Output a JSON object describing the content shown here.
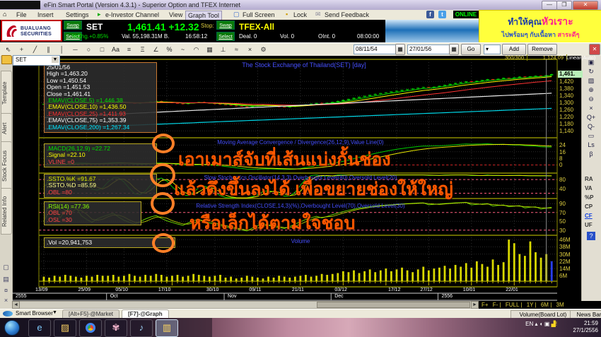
{
  "window": {
    "title": "eFin Smart Portal (Version 4.3.1) - Superior Option and TFEX Internet"
  },
  "menu": {
    "items": [
      "File",
      "Insert",
      "Settings",
      "e-Investor Channel",
      "View",
      "Graph Tool",
      "Full Screen",
      "Lock",
      "Send Feedback"
    ],
    "online": "ONLINE"
  },
  "banner": {
    "l1a": "ทำให้คุณ",
    "l1b": "หัวเราะ",
    "l2a": "ไปพร้อมๆ กับเนื้อหา",
    "l2b": "สาระดีๆ"
  },
  "quote": {
    "swap": "Swap",
    "select": "Select",
    "broker": {
      "line1": "BUALUANG",
      "line2": "SECURITIES"
    },
    "set": {
      "symbol": "SET",
      "last": "1,461.41 +12.32",
      "pct": "%Chg.+0.85%",
      "val": "Val. 55,198.31M B.",
      "time": "16:58:12",
      "stop": "Stop:"
    },
    "tfex": {
      "symbol": "TFEX-All",
      "deal": "Deal. 0",
      "vol": "Vol. 0",
      "oint": "OInt. 0",
      "time": "08:00:00"
    }
  },
  "toolbar": {
    "tools": [
      "pointer",
      "crosshair",
      "trend-line",
      "parallel-lines",
      "vertical-line",
      "horizontal-line",
      "ellipse",
      "rectangle",
      "text",
      "fibonacci",
      "extension",
      "angle",
      "percent",
      "wave",
      "arc",
      "grid",
      "ruler",
      "pattern",
      "delete",
      "settings"
    ],
    "date_from": "08/11/54",
    "date_to": "27/01/56",
    "go": "Go",
    "add": "Add",
    "remove": "Remove"
  },
  "chart_header": {
    "bars": "300/300",
    "value": "1,124.09",
    "scale": "Linear(Auto)"
  },
  "symbol_combo": {
    "value": "SET"
  },
  "sidebar": {
    "tabs": [
      "Template",
      "Alert",
      "Stock Focus",
      "Related Info"
    ]
  },
  "panes": {
    "price_title": "The Stock Exchange of Thailand(SET) [day]",
    "macd_title": "Moving Average Convergence / Divergence(26,12,9),Value Line(0)",
    "stoch_title": "Slow Stochastics Oscillator(14,3,3),Overbought Level(80),Oversold Level(20)",
    "rsi_title": "Relative Strength Index(CLOSE,14,3)(%),Overbought Level(70),Oversold Level(30)",
    "vol_title": "Volume"
  },
  "info_boxes": {
    "price": {
      "rows": [
        {
          "l": "25/01/56",
          "v": "",
          "c": "#ffffff"
        },
        {
          "l": "High",
          "v": "=1,463.20",
          "c": "#ffffff"
        },
        {
          "l": "Low",
          "v": "=1,450.54",
          "c": "#ffffff"
        },
        {
          "l": "Open",
          "v": "=1,451.53",
          "c": "#ffffff"
        },
        {
          "l": "Close",
          "v": "=1,461.41",
          "c": "#ffffff"
        },
        {
          "l": ".EMAV(CLOSE,5)",
          "v": "=1,446.38",
          "c": "#00dd00"
        },
        {
          "l": ".EMAV(CLOSE,10)",
          "v": "=1,436.50",
          "c": "#ffff00"
        },
        {
          "l": ".EMAV(CLOSE,25)",
          "v": "=1,411.93",
          "c": "#ff3333"
        },
        {
          "l": ".EMAV(CLOSE,75)",
          "v": "=1,353.39",
          "c": "#ffffff"
        },
        {
          "l": ".EMAV(CLOSE,200)",
          "v": "=1,267.34",
          "c": "#00e5ff"
        }
      ]
    },
    "macd": {
      "rows": [
        {
          "l": ".MACD(26,12,9)",
          "v": "=22.72",
          "c": "#00dd00"
        },
        {
          "l": ".Signal",
          "v": "=22.10",
          "c": "#ffff00"
        },
        {
          "l": ".VLINE",
          "v": "=0",
          "c": "#ff4444"
        }
      ]
    },
    "ssto": {
      "rows": [
        {
          "l": ".SSTO.%K",
          "v": "=91.67",
          "c": "#d8e600"
        },
        {
          "l": ".SSTO.%D",
          "v": "=85.59",
          "c": "#ffff88"
        },
        {
          "l": ".OBL",
          "v": "=80",
          "c": "#ff4444"
        }
      ]
    },
    "rsi": {
      "rows": [
        {
          "l": ".RSI(14)",
          "v": "=77.36",
          "c": "#88ff00"
        },
        {
          "l": ".OBL",
          "v": "=70",
          "c": "#ff4444"
        },
        {
          "l": ".OSL",
          "v": "=30",
          "c": "#ff4444"
        }
      ]
    },
    "vol": {
      "rows": [
        {
          "l": ".Vol",
          "v": "=20,941,753",
          "c": "#ffffff"
        }
      ]
    }
  },
  "annotations": {
    "t1": "เอาเมาส์จับที่เส้นแบ่งกั้นช่อง",
    "t2": "แล้วดึงขึ้นลงได้ เพื่อขยายช่องให้ใหญ่",
    "t3": "หรือเล็กได้ตามใจชอบ"
  },
  "scrollbar": {
    "buttons": [
      "F+",
      "F-",
      "FULL",
      "1Y",
      "6M",
      "3M"
    ]
  },
  "statusbar": {
    "browser": "Smart Browser",
    "tab_market": "[Alt+F5]-@Market",
    "tab_graph": "[F7]-@Graph",
    "volume_btn": "Volume(Board Lot)",
    "news_btn": "News Bar"
  },
  "taskbar": {
    "lang": "EN",
    "time": "21:59",
    "date": "27/1/2556"
  },
  "right_tools": [
    "chart-window",
    "refresh",
    "image",
    "zoom-in",
    "zoom-out",
    "clear",
    "magnify-plus",
    "magnify-minus",
    "monitor",
    "last-sale",
    "beta"
  ],
  "right_labels": [
    "RA",
    "VA",
    "%P",
    "CP",
    "CF",
    "UF"
  ],
  "chart_data": {
    "type": "candlestick",
    "title": "The Stock Exchange of Thailand(SET) [day]",
    "symbol": "SET",
    "interval": "day",
    "closes": [
      1293,
      1296,
      1299,
      1295,
      1300,
      1303,
      1306,
      1301,
      1298,
      1295,
      1299,
      1302,
      1305,
      1308,
      1304,
      1300,
      1297,
      1294,
      1298,
      1302,
      1306,
      1309,
      1305,
      1301,
      1298,
      1295,
      1292,
      1296,
      1300,
      1303,
      1299,
      1296,
      1293,
      1290,
      1287,
      1284,
      1281,
      1278,
      1275,
      1279,
      1283,
      1286,
      1282,
      1279,
      1276,
      1274,
      1277,
      1281,
      1285,
      1290,
      1294,
      1298,
      1295,
      1299,
      1304,
      1309,
      1315,
      1321,
      1327,
      1333,
      1338,
      1344,
      1349,
      1354,
      1358,
      1363,
      1367,
      1372,
      1376,
      1380,
      1384,
      1388,
      1385,
      1390,
      1395,
      1400,
      1406,
      1411,
      1416,
      1421,
      1417,
      1423,
      1428,
      1433,
      1429,
      1435,
      1440,
      1437,
      1442,
      1447,
      1443,
      1449,
      1452,
      1448,
      1455,
      1461
    ],
    "volumes_m": [
      5,
      4,
      6,
      5,
      7,
      6,
      5,
      4,
      6,
      5,
      7,
      6,
      6,
      7,
      5,
      6,
      8,
      6,
      5,
      7,
      6,
      8,
      7,
      5,
      6,
      7,
      5,
      6,
      8,
      7,
      6,
      5,
      6,
      7,
      4,
      5,
      3,
      4,
      6,
      5,
      4,
      3,
      5,
      4,
      6,
      5,
      4,
      5,
      6,
      7,
      5,
      6,
      8,
      7,
      8,
      9,
      11,
      10,
      12,
      9,
      11,
      13,
      10,
      12,
      14,
      11,
      13,
      15,
      12,
      10,
      13,
      16,
      12,
      14,
      15,
      17,
      14,
      18,
      16,
      20,
      15,
      22,
      19,
      16,
      24,
      18,
      21,
      46,
      42,
      30,
      28,
      44,
      32,
      26,
      30,
      22
    ],
    "overlays": {
      "ema5_last": 1446.38,
      "ema10_last": 1436.5,
      "ema25_last": 1411.93,
      "ema75_from": 1215,
      "ema75_to": 1353.39,
      "ema200_from": 1152,
      "ema200_to": 1267.34
    },
    "indicators": {
      "macd_last": 22.72,
      "signal_last": 22.1,
      "ssto_k_last": 91.67,
      "ssto_d_last": 85.59,
      "rsi_last": 77.36,
      "vol_last": "20,941,753"
    },
    "ranges": {
      "price": [
        1105,
        1545
      ],
      "macd": [
        -9,
        32
      ],
      "stoch": [
        0,
        105
      ],
      "rsi": [
        20,
        100
      ],
      "vol_m": [
        0,
        50
      ]
    },
    "levels": {
      "stoch_ob": 80,
      "stoch_os": 20,
      "rsi_ob": 70,
      "rsi_os": 30,
      "macd_zero": 0
    },
    "axis": {
      "price_ticks": [
        {
          "label": "1,420",
          "v": 1420
        },
        {
          "label": "1,380",
          "v": 1380
        },
        {
          "label": "1,340",
          "v": 1340
        },
        {
          "label": "1,300",
          "v": 1300
        },
        {
          "label": "1,260",
          "v": 1260
        },
        {
          "label": "1,220",
          "v": 1220
        },
        {
          "label": "1,180",
          "v": 1180
        },
        {
          "label": "1,140",
          "v": 1140
        }
      ],
      "price_current": {
        "label": "1,461.",
        "v": 1461
      },
      "macd_ticks": [
        24,
        16,
        8,
        0
      ],
      "stoch_ticks": [
        80,
        40
      ],
      "rsi_ticks": [
        90,
        70,
        50,
        30
      ],
      "vol_ticks": [
        {
          "label": "46M",
          "v": 46
        },
        {
          "label": "38M",
          "v": 38
        },
        {
          "label": "30M",
          "v": 30
        },
        {
          "label": "22M",
          "v": 22
        },
        {
          "label": "14M",
          "v": 14
        },
        {
          "label": "6M",
          "v": 6
        }
      ],
      "dates": [
        {
          "label": "13/09",
          "i": 0
        },
        {
          "label": "25/09",
          "i": 8
        },
        {
          "label": "05/10",
          "i": 15
        },
        {
          "label": "17/10",
          "i": 23
        },
        {
          "label": "30/10",
          "i": 32
        },
        {
          "label": "09/11",
          "i": 40
        },
        {
          "label": "21/11",
          "i": 48
        },
        {
          "label": "03/12",
          "i": 56
        },
        {
          "label": "17/12",
          "i": 66
        },
        {
          "label": "27/12",
          "i": 72
        },
        {
          "label": "10/01",
          "i": 80
        },
        {
          "label": "22/01",
          "i": 88
        }
      ],
      "months": [
        {
          "label": "Oct",
          "i": 12
        },
        {
          "label": "Nov",
          "i": 34
        },
        {
          "label": "Dec",
          "i": 54
        },
        {
          "label": "2556",
          "i": 74
        }
      ],
      "year_left": "2555"
    }
  }
}
